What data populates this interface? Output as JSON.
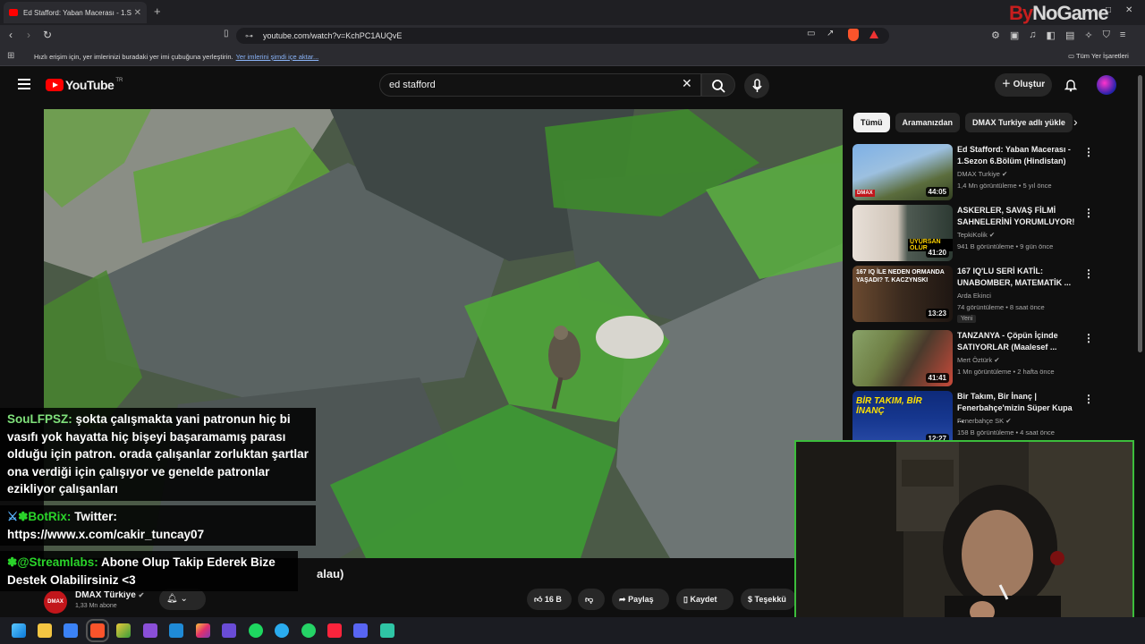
{
  "browser": {
    "tab_title": "Ed Stafford: Yaban Macerası - 1.S",
    "tab_close": "✕",
    "new_tab": "+",
    "url": "youtube.com/watch?v=KchPC1AUQvE",
    "bookmarks_hint": "Hızlı erişim için, yer imlerinizi buradaki yer imi çubuğuna yerleştirin.",
    "bookmarks_link": "Yer imlerini şimdi içe aktar...",
    "all_bookmarks": "Tüm Yer İşaretleri",
    "watermark_prefix": "By",
    "watermark_suffix": "NoGame"
  },
  "youtube": {
    "logo_text": "YouTube",
    "region": "TR",
    "search_query": "ed stafford",
    "create_label": "Oluştur"
  },
  "video": {
    "title_fragment": "alau)",
    "channel": "DMAX Türkiye",
    "channel_logo": "DMAX",
    "subscribers": "1,33 Mn abone",
    "likes": "16 B",
    "share": "Paylaş",
    "save": "Kaydet",
    "thanks": "Teşekkü"
  },
  "chips": [
    "Tümü",
    "Aramanızdan",
    "DMAX Turkiye adlı yükle"
  ],
  "recommendations": [
    {
      "title": "Ed Stafford: Yaban Macerası - 1.Sezon 6.Bölüm (Hindistan)",
      "channel": "DMAX Turkiye",
      "meta": "1,4 Mn görüntüleme • 5 yıl önce",
      "duration": "44:05",
      "verified": true,
      "badge": "",
      "thumb_text": "DMAX"
    },
    {
      "title": "ASKERLER, SAVAŞ FİLMİ SAHNELERİNİ YORUMLUYOR!",
      "channel": "TepkiKolik",
      "meta": "941 B görüntüleme • 9 gün önce",
      "duration": "41:20",
      "verified": true,
      "badge": "",
      "thumb_text": "UYURSAN ÖLÜR"
    },
    {
      "title": "167 IQ'LU SERİ KATİL: UNABOMBER, MATEMATİK ...",
      "channel": "Arda Ekinci",
      "meta": "74 görüntüleme • 8 saat önce",
      "duration": "13:23",
      "verified": false,
      "badge": "Yeni",
      "thumb_text": "167 IQ İLE NEDEN ORMANDA YAŞADI? T. KACZYNSKI"
    },
    {
      "title": "TANZANYA - Çöpün İçinde SATIYORLAR (Maalesef ...",
      "channel": "Mert Öztürk",
      "meta": "1 Mn görüntüleme • 2 hafta önce",
      "duration": "41:41",
      "verified": true,
      "badge": "",
      "thumb_text": ""
    },
    {
      "title": "Bir Takım, Bir İnanç | Fenerbahçe'mizin Süper Kupa ...",
      "channel": "Fenerbahçe SK",
      "meta": "158 B görüntüleme • 4 saat önce",
      "duration": "12:27",
      "verified": true,
      "badge": "",
      "thumb_text": "BİR TAKIM, BİR İNANÇ"
    }
  ],
  "chat": [
    {
      "user": "SouLFPSZ:",
      "text": "şokta çalışmakta yani patronun hiç bi vasıfı yok hayatta hiç bişeyi başaramamış parası olduğu için patron. orada çalışanlar zorluktan şartlar ona verdiği için çalışıyor ve genelde patronlar ezikliyor çalışanları"
    },
    {
      "user": "BotRix:",
      "text": "Twitter: https://www.x.com/cakir_tuncay07"
    },
    {
      "user": "@Streamlabs:",
      "text": "Abone Olup Takip Ederek Bize Destek Olabilirsiniz <3"
    }
  ],
  "colors": {
    "brand": "#ff0000",
    "chat_name": "#7fe07a",
    "cam_border": "#3cbd3c"
  }
}
